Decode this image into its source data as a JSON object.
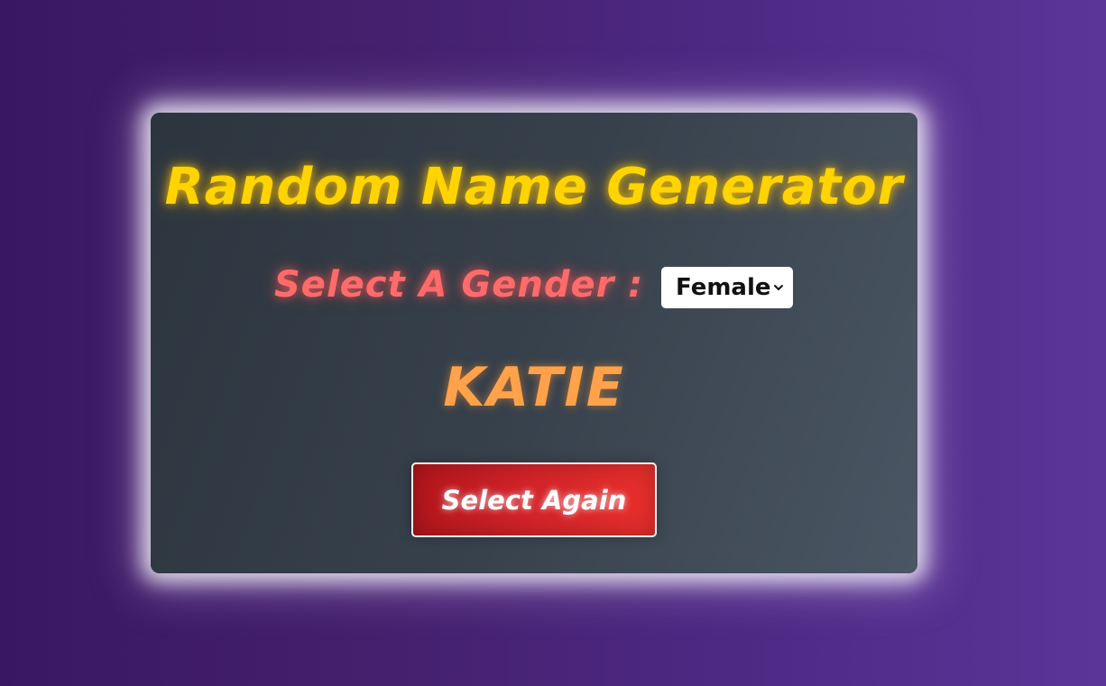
{
  "app": {
    "title": "Random Name Generator"
  },
  "gender": {
    "label": "Select A Gender :",
    "selected": "Female",
    "chevron_icon": "chevron-down-icon"
  },
  "result": {
    "name": "KATIE"
  },
  "actions": {
    "select_again_label": "Select Again"
  },
  "colors": {
    "title": "#ffd400",
    "label": "#ff6b6b",
    "name": "#ffa24a",
    "button": "#d4242a",
    "card": "#37414c",
    "background": "#45206e"
  }
}
